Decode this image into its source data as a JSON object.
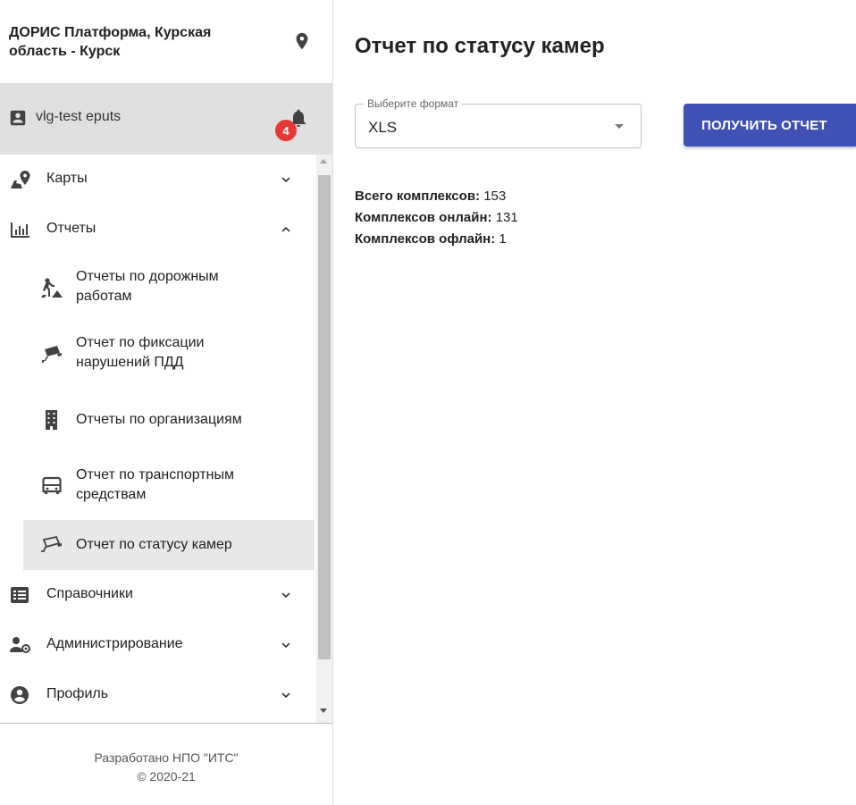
{
  "sidebar": {
    "title": "ДОРИС Платформа, Курская область - Курск",
    "user": {
      "name": "vlg-test eputs",
      "notifications": "4"
    },
    "menu": {
      "maps": "Карты",
      "reports": "Отчеты",
      "reports_sub": [
        "Отчеты по дорожным работам",
        "Отчет по фиксации нарушений ПДД",
        "Отчеты по организациям",
        "Отчет по транспортным средствам",
        "Отчет по статусу камер"
      ],
      "directories": "Справочники",
      "administration": "Администрирование",
      "profile": "Профиль"
    },
    "footer_line1": "Разработано НПО \"ИТС\"",
    "footer_line2": "© 2020-21"
  },
  "main": {
    "title": "Отчет по статусу камер",
    "format_select": {
      "legend": "Выберите формат",
      "value": "XLS"
    },
    "get_report_button": "ПОЛУЧИТЬ ОТЧЕТ",
    "stats": {
      "total_label": "Всего комплексов:",
      "total_value": "153",
      "online_label": "Комплексов онлайн:",
      "online_value": "131",
      "offline_label": "Комплексов офлайн:",
      "offline_value": "1"
    }
  },
  "colors": {
    "accent": "#3f51b5",
    "badge": "#e53935",
    "active_item_bg": "#e8e8e8",
    "user_row_bg": "#e0e0e0",
    "icon": "#424242"
  },
  "icons": {
    "location": "location-pin-icon",
    "user": "account-box-icon",
    "bell": "bell-icon",
    "maps": "map-pin-icon",
    "reports": "bar-chart-icon",
    "road_works": "road-work-icon",
    "traffic_camera": "traffic-camera-icon",
    "organizations": "building-icon",
    "vehicles": "bus-icon",
    "camera_status": "camera-outline-icon",
    "directories": "list-icon",
    "administration": "people-gear-icon",
    "profile": "account-circle-icon"
  }
}
